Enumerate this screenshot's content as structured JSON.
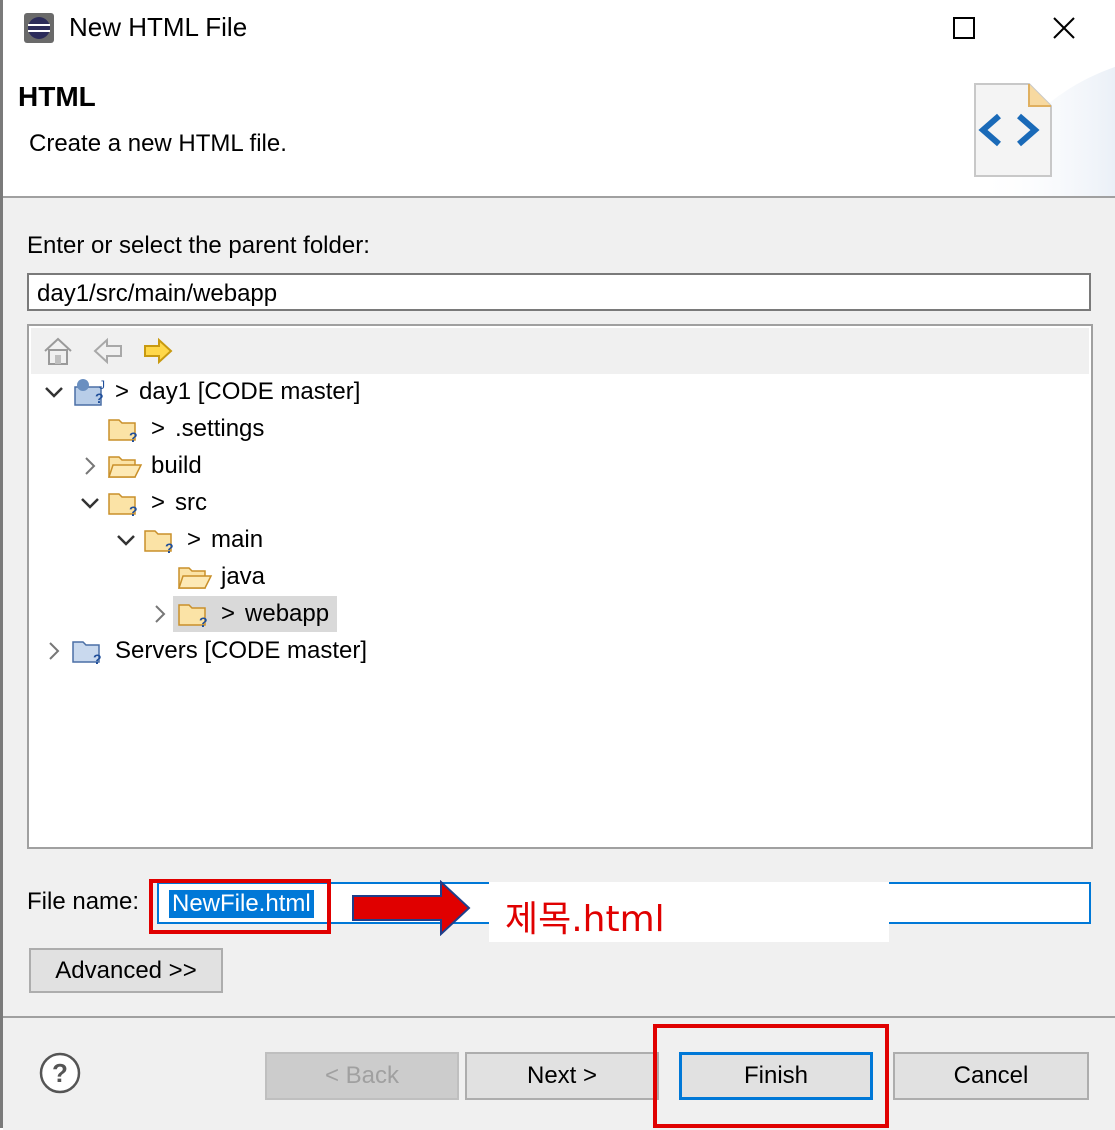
{
  "window": {
    "title": "New HTML File",
    "controls": {
      "minimize": "minimize-icon",
      "maximize": "maximize-icon",
      "close": "close-icon"
    }
  },
  "header": {
    "title": "HTML",
    "description": "Create a new HTML file."
  },
  "parent_folder": {
    "label": "Enter or select the parent folder:",
    "value": "day1/src/main/webapp"
  },
  "tree": {
    "toolbar": [
      "home-icon",
      "back-arrow-icon",
      "forward-arrow-icon"
    ],
    "items": [
      {
        "label": "day1 [CODE master]",
        "prefix": ">",
        "expanded": true
      },
      {
        "label": ".settings",
        "prefix": ">"
      },
      {
        "label": "build",
        "prefix": "",
        "expanded": false
      },
      {
        "label": "src",
        "prefix": ">",
        "expanded": true
      },
      {
        "label": "main",
        "prefix": ">",
        "expanded": true
      },
      {
        "label": "java",
        "prefix": ""
      },
      {
        "label": "webapp",
        "prefix": ">",
        "expanded": false,
        "selected": true
      },
      {
        "label": "Servers [CODE master]",
        "prefix": "",
        "expanded": false
      }
    ]
  },
  "file_name": {
    "label": "File name:",
    "value": "NewFile.html"
  },
  "annotation": {
    "text": "제목.html",
    "color": "#e00000"
  },
  "buttons": {
    "advanced": "Advanced >>",
    "back": "< Back",
    "next": "Next >",
    "finish": "Finish",
    "cancel": "Cancel"
  },
  "colors": {
    "accent": "#0078d7",
    "highlight": "#e00000"
  }
}
